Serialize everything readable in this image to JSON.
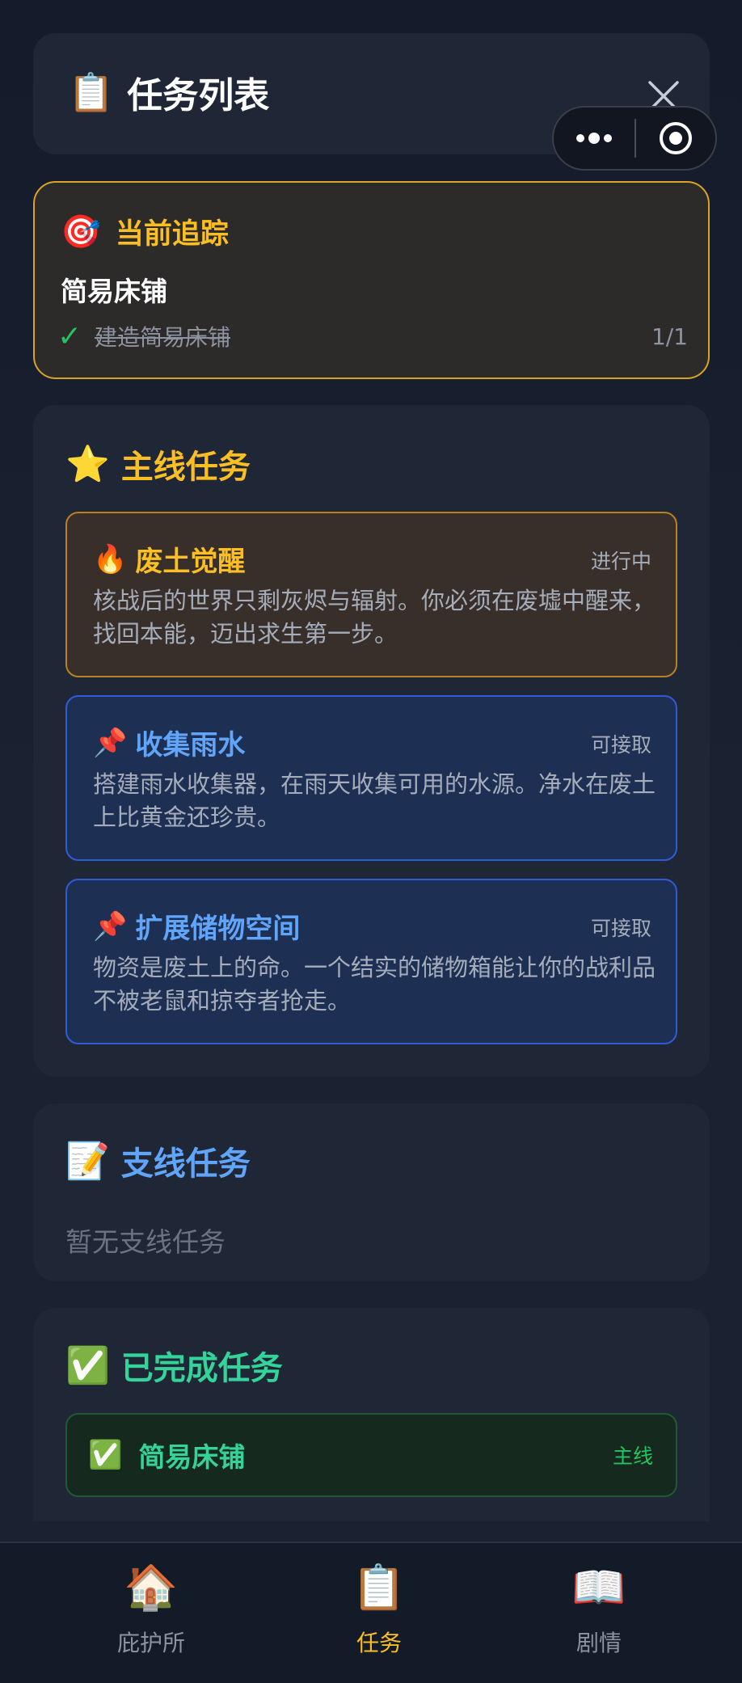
{
  "header": {
    "icon": "clipboard-icon",
    "emoji": "📋",
    "title": "任务列表"
  },
  "tracking": {
    "icon": "target-icon",
    "emoji": "🎯",
    "heading": "当前追踪",
    "quest_name": "简易床铺",
    "objective": "建造简易床铺",
    "check": "✓",
    "progress": "1/1"
  },
  "main_section": {
    "emoji": "⭐",
    "title": "主线任务",
    "title_color": "#fbbf24",
    "quests": [
      {
        "emoji": "🔥",
        "name": "废土觉醒",
        "status": "进行中",
        "desc": "核战后的世界只剩灰烬与辐射。你必须在废墟中醒来，找回本能，迈出求生第一步。"
      },
      {
        "emoji": "📌",
        "name": "收集雨水",
        "status": "可接取",
        "desc": "搭建雨水收集器，在雨天收集可用的水源。净水在废土上比黄金还珍贵。"
      },
      {
        "emoji": "📌",
        "name": "扩展储物空间",
        "status": "可接取",
        "desc": "物资是废土上的命。一个结实的储物箱能让你的战利品不被老鼠和掠夺者抢走。"
      }
    ]
  },
  "side_section": {
    "emoji": "📝",
    "title": "支线任务",
    "title_color": "#60a5fa",
    "empty_text": "暂无支线任务"
  },
  "done_section": {
    "emoji": "✅",
    "title": "已完成任务",
    "title_color": "#34d399",
    "items": [
      {
        "emoji": "✅",
        "name": "简易床铺",
        "tag": "主线"
      }
    ]
  },
  "nav": {
    "items": [
      {
        "emoji": "🏠",
        "label": "庇护所",
        "icon": "house-icon"
      },
      {
        "emoji": "📋",
        "label": "任务",
        "icon": "clipboard-icon"
      },
      {
        "emoji": "📖",
        "label": "剧情",
        "icon": "book-icon"
      }
    ],
    "active_index": 1
  }
}
